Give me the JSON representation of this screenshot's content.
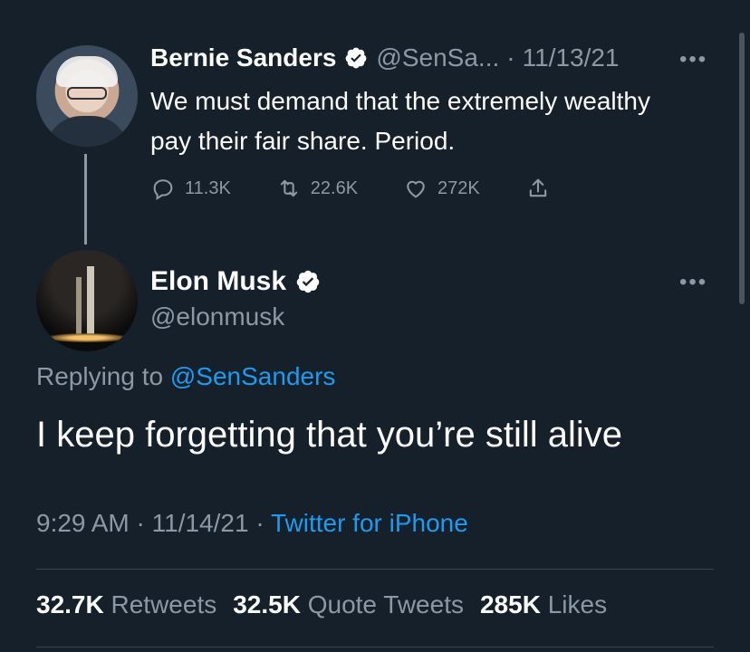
{
  "parent_tweet": {
    "display_name": "Bernie Sanders",
    "handle": "@SenSa...",
    "separator": "·",
    "date": "11/13/21",
    "more": "•••",
    "text": "We must demand that the extremely wealthy pay their fair share. Period.",
    "actions": {
      "replies": "11.3K",
      "retweets": "22.6K",
      "likes": "272K"
    }
  },
  "reply_tweet": {
    "display_name": "Elon Musk",
    "handle": "@elonmusk",
    "more": "•••",
    "replying_prefix": "Replying to",
    "replying_to": "@SenSanders",
    "text": "I keep forgetting that you’re still alive",
    "time": "9:29 AM",
    "separator": "·",
    "date": "11/14/21",
    "source": "Twitter for iPhone",
    "stats": {
      "retweets_count": "32.7K",
      "retweets_label": "Retweets",
      "quotes_count": "32.5K",
      "quotes_label": "Quote Tweets",
      "likes_count": "285K",
      "likes_label": "Likes"
    }
  },
  "icons": [
    "verified-badge-icon",
    "reply-icon",
    "retweet-icon",
    "like-icon",
    "share-icon",
    "more-icon"
  ],
  "colors": {
    "background": "#15202b",
    "text": "#ffffff",
    "muted": "#8b98a5",
    "link": "#1d9bf0",
    "divider": "#38444d"
  }
}
